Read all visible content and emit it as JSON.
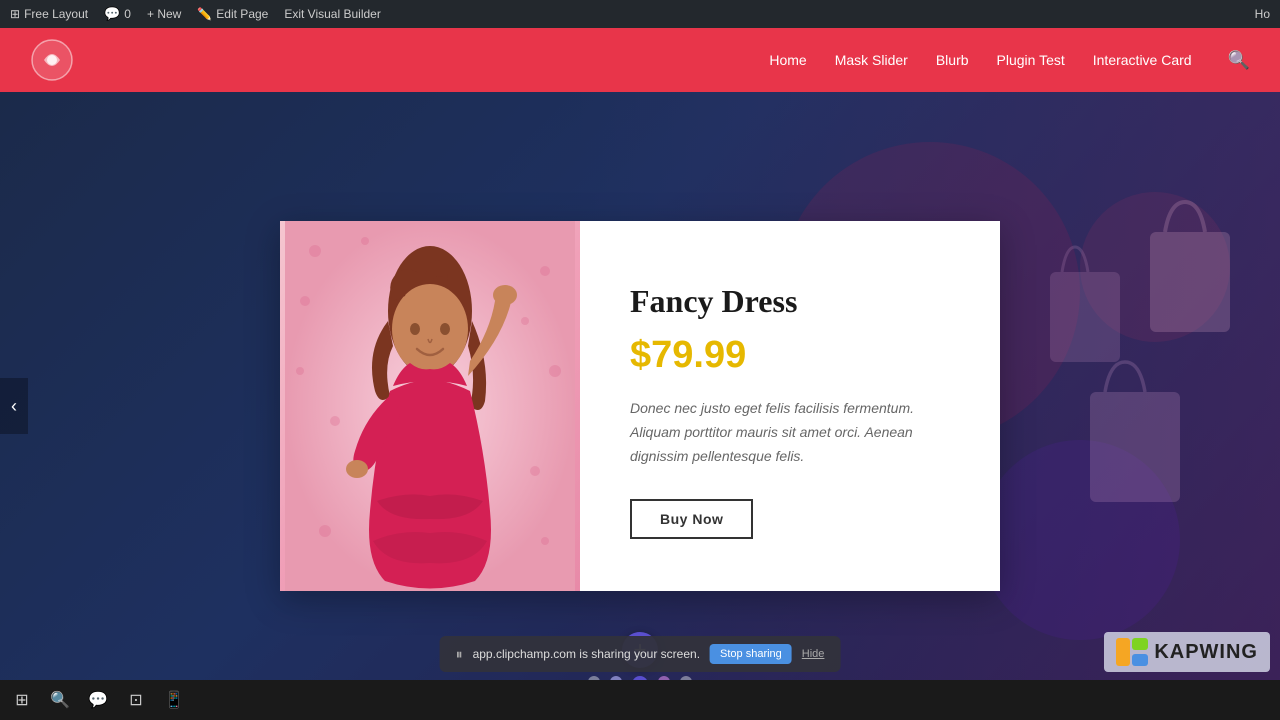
{
  "admin_bar": {
    "free_layout": "Free Layout",
    "comments_icon": "💬",
    "comments_count": "0",
    "new_label": "+ New",
    "edit_page_label": "Edit Page",
    "exit_builder_label": "Exit Visual Builder",
    "right_text": "Ho"
  },
  "nav": {
    "home": "Home",
    "mask_slider": "Mask Slider",
    "blurb": "Blurb",
    "plugin_test": "Plugin Test",
    "interactive_card": "Interactive Card"
  },
  "product": {
    "name": "Fancy Dress",
    "price": "$79.99",
    "description": "Donec nec justo eget felis facilisis fermentum. Aliquam porttitor mauris sit amet orci. Aenean dignissim pellentesque felis.",
    "buy_button": "Buy Now"
  },
  "toolbar": {
    "icons": [
      "⊞",
      "🔍",
      "💬",
      "⊡",
      "📱"
    ]
  },
  "screen_share": {
    "message": "app.clipchamp.com is sharing your screen.",
    "stop_button": "Stop sharing",
    "hide_button": "Hide"
  },
  "kapwing": {
    "text": "KAPWING"
  },
  "carousel": {
    "dots": 5,
    "active_index": 2
  }
}
